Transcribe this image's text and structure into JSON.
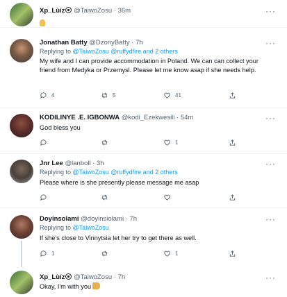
{
  "tweets": [
    {
      "name": "Xp_Lùíz",
      "handle": "@TaiwoZosu",
      "time": "· 36m",
      "text": "",
      "reply_prefix": "",
      "reply_to": ""
    },
    {
      "name": "Jonathan Batty",
      "handle": "@DzonyBatty",
      "time": "· 7h",
      "reply_prefix": "Replying to",
      "reply_to": "@TaiwoZosu @ruffydfire and 2 others",
      "text": "My wife and I can provide accommodation in Poland. We can can collect your friend from Medyka or Przemysl. Please let me know asap if she needs help.",
      "replies": "4",
      "retweets": "5",
      "likes": "41"
    },
    {
      "name": "KODILINYE .E. IGBONWA",
      "handle": "@kodi_Ezekwesili",
      "time": "· 54m",
      "text": "God bless you",
      "replies": "",
      "retweets": "",
      "likes": "1"
    },
    {
      "name": "Jnr Lee",
      "handle": "@lanboll",
      "time": "· 3h",
      "reply_prefix": "Replying to",
      "reply_to": "@TaiwoZosu @ruffydfire and 2 others",
      "text": "Please where is she presently please message me asap",
      "replies": "",
      "retweets": "",
      "likes": ""
    },
    {
      "name": "Doyinsolami",
      "handle": "@doyinsiolami",
      "time": "· 7h",
      "reply_prefix": "Replying to",
      "reply_to": "@TaiwoZosu",
      "text": "If she's close to Vinnytsia let her try to get there as well.",
      "replies": "1",
      "retweets": "",
      "likes": "1"
    },
    {
      "name": "Xp_Lùíz",
      "handle": "@TaiwoZosu",
      "time": "· 7h",
      "text": "Okay, I'm with you",
      "replies": "",
      "retweets": "",
      "likes": ""
    }
  ],
  "more_label": "···",
  "colors": {
    "link": "#1d9bf0",
    "muted": "#536471",
    "divider": "#eff3f4"
  },
  "icons": [
    "reply-icon",
    "retweet-icon",
    "like-icon",
    "share-icon",
    "more-icon"
  ]
}
